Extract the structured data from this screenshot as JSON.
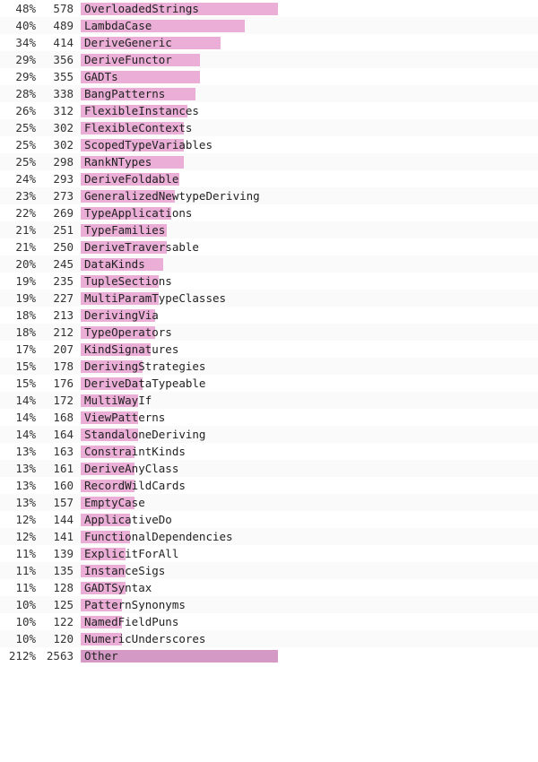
{
  "rows": [
    {
      "pct": "48%",
      "count": "578",
      "label": "OverloadedStrings",
      "bar_pct": 48
    },
    {
      "pct": "40%",
      "count": "489",
      "label": "LambdaCase",
      "bar_pct": 40
    },
    {
      "pct": "34%",
      "count": "414",
      "label": "DeriveGeneric",
      "bar_pct": 34
    },
    {
      "pct": "29%",
      "count": "356",
      "label": "DeriveFunctor",
      "bar_pct": 29
    },
    {
      "pct": "29%",
      "count": "355",
      "label": "GADTs",
      "bar_pct": 29
    },
    {
      "pct": "28%",
      "count": "338",
      "label": "BangPatterns",
      "bar_pct": 28
    },
    {
      "pct": "26%",
      "count": "312",
      "label": "FlexibleInstances",
      "bar_pct": 26
    },
    {
      "pct": "25%",
      "count": "302",
      "label": "FlexibleContexts",
      "bar_pct": 25
    },
    {
      "pct": "25%",
      "count": "302",
      "label": "ScopedTypeVariables",
      "bar_pct": 25
    },
    {
      "pct": "25%",
      "count": "298",
      "label": "RankNTypes",
      "bar_pct": 25
    },
    {
      "pct": "24%",
      "count": "293",
      "label": "DeriveFoldable",
      "bar_pct": 24
    },
    {
      "pct": "23%",
      "count": "273",
      "label": "GeneralizedNewtypeDeriving",
      "bar_pct": 23
    },
    {
      "pct": "22%",
      "count": "269",
      "label": "TypeApplications",
      "bar_pct": 22
    },
    {
      "pct": "21%",
      "count": "251",
      "label": "TypeFamilies",
      "bar_pct": 21
    },
    {
      "pct": "21%",
      "count": "250",
      "label": "DeriveTraversable",
      "bar_pct": 21
    },
    {
      "pct": "20%",
      "count": "245",
      "label": "DataKinds",
      "bar_pct": 20
    },
    {
      "pct": "19%",
      "count": "235",
      "label": "TupleSections",
      "bar_pct": 19
    },
    {
      "pct": "19%",
      "count": "227",
      "label": "MultiParamTypeClasses",
      "bar_pct": 19
    },
    {
      "pct": "18%",
      "count": "213",
      "label": "DerivingVia",
      "bar_pct": 18
    },
    {
      "pct": "18%",
      "count": "212",
      "label": "TypeOperators",
      "bar_pct": 18
    },
    {
      "pct": "17%",
      "count": "207",
      "label": "KindSignatures",
      "bar_pct": 17
    },
    {
      "pct": "15%",
      "count": "178",
      "label": "DerivingStrategies",
      "bar_pct": 15
    },
    {
      "pct": "15%",
      "count": "176",
      "label": "DeriveDataTypeable",
      "bar_pct": 15
    },
    {
      "pct": "14%",
      "count": "172",
      "label": "MultiWayIf",
      "bar_pct": 14
    },
    {
      "pct": "14%",
      "count": "168",
      "label": "ViewPatterns",
      "bar_pct": 14
    },
    {
      "pct": "14%",
      "count": "164",
      "label": "StandaloneDeriving",
      "bar_pct": 14
    },
    {
      "pct": "13%",
      "count": "163",
      "label": "ConstraintKinds",
      "bar_pct": 13
    },
    {
      "pct": "13%",
      "count": "161",
      "label": "DeriveAnyClass",
      "bar_pct": 13
    },
    {
      "pct": "13%",
      "count": "160",
      "label": "RecordWildCards",
      "bar_pct": 13
    },
    {
      "pct": "13%",
      "count": "157",
      "label": "EmptyCase",
      "bar_pct": 13
    },
    {
      "pct": "12%",
      "count": "144",
      "label": "ApplicativeDo",
      "bar_pct": 12
    },
    {
      "pct": "12%",
      "count": "141",
      "label": "FunctionalDependencies",
      "bar_pct": 12
    },
    {
      "pct": "11%",
      "count": "139",
      "label": "ExplicitForAll",
      "bar_pct": 11
    },
    {
      "pct": "11%",
      "count": "135",
      "label": "InstanceSigs",
      "bar_pct": 11
    },
    {
      "pct": "11%",
      "count": "128",
      "label": "GADTSyntax",
      "bar_pct": 11
    },
    {
      "pct": "10%",
      "count": "125",
      "label": "PatternSynonyms",
      "bar_pct": 10
    },
    {
      "pct": "10%",
      "count": "122",
      "label": "NamedFieldPuns",
      "bar_pct": 10
    },
    {
      "pct": "10%",
      "count": "120",
      "label": "NumericUnderscores",
      "bar_pct": 10
    },
    {
      "pct": "212%",
      "count": "2563",
      "label": "Other",
      "bar_pct": 100,
      "is_other": true
    }
  ],
  "max_bar_width": 220
}
